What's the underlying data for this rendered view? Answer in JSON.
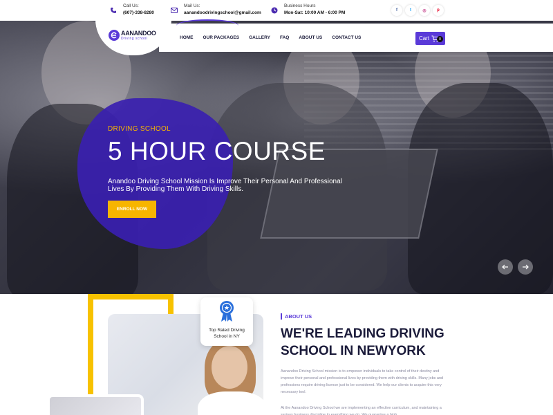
{
  "topbar": {
    "call": {
      "label": "Call Us:",
      "value": "(607)-338-8280",
      "icon": "phone-icon"
    },
    "mail": {
      "label": "Mail Us:",
      "value": "aanandoodrivingschool@gmail.com",
      "icon": "mail-icon"
    },
    "hours": {
      "label": "Business Hours",
      "value": "Mon-Sat: 10:00 AM - 6:00 PM",
      "icon": "clock-icon"
    },
    "socials": [
      {
        "icon": "facebook-icon",
        "glyph": "f",
        "color": "#3b5998"
      },
      {
        "icon": "twitter-icon",
        "glyph": "t",
        "color": "#1da1f2"
      },
      {
        "icon": "instagram-icon",
        "glyph": "◎",
        "color": "#c13584"
      },
      {
        "icon": "pinterest-icon",
        "glyph": "p",
        "color": "#e60023"
      }
    ]
  },
  "nav": {
    "logo_text": "AANANDOO",
    "logo_sub": "Driving school",
    "items": [
      "HOME",
      "OUR PACKAGES",
      "GALLERY",
      "FAQ",
      "ABOUT US",
      "CONTACT US"
    ],
    "cart_label": "Cart",
    "cart_count": "0"
  },
  "hero": {
    "subtitle": "DRIVING SCHOOL",
    "title": "5 HOUR COURSE",
    "text": "Anandoo Driving School Mission Is Improve Their Personal And Professional Lives By Providing Them With Driving Skills.",
    "cta": "ENROLL NOW",
    "prev": "‹",
    "next": "›"
  },
  "about": {
    "badge_text": "Top Rated Driving School in NY",
    "tag": "ABOUT US",
    "title": "WE'RE LEADING DRIVING SCHOOL IN NEWYORK",
    "p1": "Aanandoo Driving School mission is to empower individuals to take control of their destiny and improve their personal and professional lives by providing them with driving skills. Many jobs and professions require driving license just to be considered. We help our clients to acquire this very necessary tool.",
    "p2": "At the Aanandoo Driving School we are implementing an effective curriculum, and maintaining a serious business discipline to everything we do. We guarantee a high"
  },
  "colors": {
    "primary": "#5a3ad8",
    "accent": "#f7b500"
  }
}
